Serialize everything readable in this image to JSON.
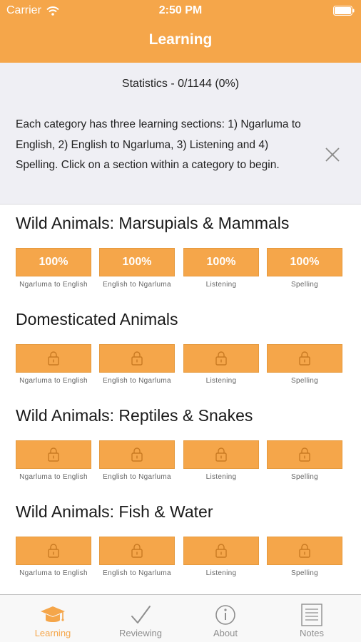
{
  "status_bar": {
    "carrier": "Carrier",
    "time": "2:50 PM"
  },
  "nav": {
    "title": "Learning"
  },
  "info": {
    "statistics": "Statistics - 0/1144 (0%)",
    "description": "Each category has three learning sections: 1) Ngarluma to English, 2) English to Ngarluma, 3) Listening and 4) Spelling. Click on a section within a category to begin."
  },
  "categories": [
    {
      "title": "Wild Animals: Marsupials & Mammals",
      "sections": [
        {
          "value": "100%",
          "caption": "Ngarluma to English",
          "locked": false
        },
        {
          "value": "100%",
          "caption": "English to Ngarluma",
          "locked": false
        },
        {
          "value": "100%",
          "caption": "Listening",
          "locked": false
        },
        {
          "value": "100%",
          "caption": "Spelling",
          "locked": false
        }
      ]
    },
    {
      "title": "Domesticated Animals",
      "sections": [
        {
          "value": "",
          "caption": "Ngarluma to English",
          "locked": true
        },
        {
          "value": "",
          "caption": "English to Ngarluma",
          "locked": true
        },
        {
          "value": "",
          "caption": "Listening",
          "locked": true
        },
        {
          "value": "",
          "caption": "Spelling",
          "locked": true
        }
      ]
    },
    {
      "title": "Wild Animals: Reptiles & Snakes",
      "sections": [
        {
          "value": "",
          "caption": "Ngarluma to English",
          "locked": true
        },
        {
          "value": "",
          "caption": "English to Ngarluma",
          "locked": true
        },
        {
          "value": "",
          "caption": "Listening",
          "locked": true
        },
        {
          "value": "",
          "caption": "Spelling",
          "locked": true
        }
      ]
    },
    {
      "title": "Wild Animals: Fish & Water",
      "sections": [
        {
          "value": "",
          "caption": "Ngarluma to English",
          "locked": true
        },
        {
          "value": "",
          "caption": "English to Ngarluma",
          "locked": true
        },
        {
          "value": "",
          "caption": "Listening",
          "locked": true
        },
        {
          "value": "",
          "caption": "Spelling",
          "locked": true
        }
      ]
    }
  ],
  "tabs": [
    {
      "label": "Learning",
      "icon": "graduation-cap-icon",
      "active": true
    },
    {
      "label": "Reviewing",
      "icon": "checkmark-icon",
      "active": false
    },
    {
      "label": "About",
      "icon": "info-icon",
      "active": false
    },
    {
      "label": "Notes",
      "icon": "notes-icon",
      "active": false
    }
  ],
  "colors": {
    "accent": "#f5a64a",
    "inactive_tab": "#8e8e8e",
    "info_background": "#efeff4"
  }
}
